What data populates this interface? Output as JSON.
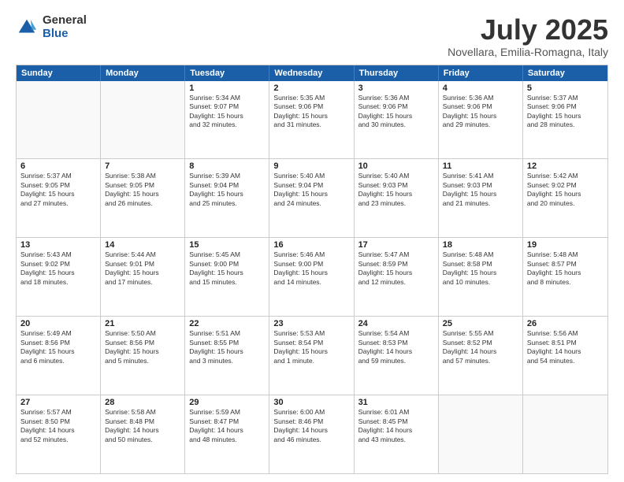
{
  "logo": {
    "general": "General",
    "blue": "Blue"
  },
  "title": "July 2025",
  "location": "Novellara, Emilia-Romagna, Italy",
  "weekdays": [
    "Sunday",
    "Monday",
    "Tuesday",
    "Wednesday",
    "Thursday",
    "Friday",
    "Saturday"
  ],
  "weeks": [
    [
      {
        "day": "",
        "detail": ""
      },
      {
        "day": "",
        "detail": ""
      },
      {
        "day": "1",
        "detail": "Sunrise: 5:34 AM\nSunset: 9:07 PM\nDaylight: 15 hours\nand 32 minutes."
      },
      {
        "day": "2",
        "detail": "Sunrise: 5:35 AM\nSunset: 9:06 PM\nDaylight: 15 hours\nand 31 minutes."
      },
      {
        "day": "3",
        "detail": "Sunrise: 5:36 AM\nSunset: 9:06 PM\nDaylight: 15 hours\nand 30 minutes."
      },
      {
        "day": "4",
        "detail": "Sunrise: 5:36 AM\nSunset: 9:06 PM\nDaylight: 15 hours\nand 29 minutes."
      },
      {
        "day": "5",
        "detail": "Sunrise: 5:37 AM\nSunset: 9:06 PM\nDaylight: 15 hours\nand 28 minutes."
      }
    ],
    [
      {
        "day": "6",
        "detail": "Sunrise: 5:37 AM\nSunset: 9:05 PM\nDaylight: 15 hours\nand 27 minutes."
      },
      {
        "day": "7",
        "detail": "Sunrise: 5:38 AM\nSunset: 9:05 PM\nDaylight: 15 hours\nand 26 minutes."
      },
      {
        "day": "8",
        "detail": "Sunrise: 5:39 AM\nSunset: 9:04 PM\nDaylight: 15 hours\nand 25 minutes."
      },
      {
        "day": "9",
        "detail": "Sunrise: 5:40 AM\nSunset: 9:04 PM\nDaylight: 15 hours\nand 24 minutes."
      },
      {
        "day": "10",
        "detail": "Sunrise: 5:40 AM\nSunset: 9:03 PM\nDaylight: 15 hours\nand 23 minutes."
      },
      {
        "day": "11",
        "detail": "Sunrise: 5:41 AM\nSunset: 9:03 PM\nDaylight: 15 hours\nand 21 minutes."
      },
      {
        "day": "12",
        "detail": "Sunrise: 5:42 AM\nSunset: 9:02 PM\nDaylight: 15 hours\nand 20 minutes."
      }
    ],
    [
      {
        "day": "13",
        "detail": "Sunrise: 5:43 AM\nSunset: 9:02 PM\nDaylight: 15 hours\nand 18 minutes."
      },
      {
        "day": "14",
        "detail": "Sunrise: 5:44 AM\nSunset: 9:01 PM\nDaylight: 15 hours\nand 17 minutes."
      },
      {
        "day": "15",
        "detail": "Sunrise: 5:45 AM\nSunset: 9:00 PM\nDaylight: 15 hours\nand 15 minutes."
      },
      {
        "day": "16",
        "detail": "Sunrise: 5:46 AM\nSunset: 9:00 PM\nDaylight: 15 hours\nand 14 minutes."
      },
      {
        "day": "17",
        "detail": "Sunrise: 5:47 AM\nSunset: 8:59 PM\nDaylight: 15 hours\nand 12 minutes."
      },
      {
        "day": "18",
        "detail": "Sunrise: 5:48 AM\nSunset: 8:58 PM\nDaylight: 15 hours\nand 10 minutes."
      },
      {
        "day": "19",
        "detail": "Sunrise: 5:48 AM\nSunset: 8:57 PM\nDaylight: 15 hours\nand 8 minutes."
      }
    ],
    [
      {
        "day": "20",
        "detail": "Sunrise: 5:49 AM\nSunset: 8:56 PM\nDaylight: 15 hours\nand 6 minutes."
      },
      {
        "day": "21",
        "detail": "Sunrise: 5:50 AM\nSunset: 8:56 PM\nDaylight: 15 hours\nand 5 minutes."
      },
      {
        "day": "22",
        "detail": "Sunrise: 5:51 AM\nSunset: 8:55 PM\nDaylight: 15 hours\nand 3 minutes."
      },
      {
        "day": "23",
        "detail": "Sunrise: 5:53 AM\nSunset: 8:54 PM\nDaylight: 15 hours\nand 1 minute."
      },
      {
        "day": "24",
        "detail": "Sunrise: 5:54 AM\nSunset: 8:53 PM\nDaylight: 14 hours\nand 59 minutes."
      },
      {
        "day": "25",
        "detail": "Sunrise: 5:55 AM\nSunset: 8:52 PM\nDaylight: 14 hours\nand 57 minutes."
      },
      {
        "day": "26",
        "detail": "Sunrise: 5:56 AM\nSunset: 8:51 PM\nDaylight: 14 hours\nand 54 minutes."
      }
    ],
    [
      {
        "day": "27",
        "detail": "Sunrise: 5:57 AM\nSunset: 8:50 PM\nDaylight: 14 hours\nand 52 minutes."
      },
      {
        "day": "28",
        "detail": "Sunrise: 5:58 AM\nSunset: 8:48 PM\nDaylight: 14 hours\nand 50 minutes."
      },
      {
        "day": "29",
        "detail": "Sunrise: 5:59 AM\nSunset: 8:47 PM\nDaylight: 14 hours\nand 48 minutes."
      },
      {
        "day": "30",
        "detail": "Sunrise: 6:00 AM\nSunset: 8:46 PM\nDaylight: 14 hours\nand 46 minutes."
      },
      {
        "day": "31",
        "detail": "Sunrise: 6:01 AM\nSunset: 8:45 PM\nDaylight: 14 hours\nand 43 minutes."
      },
      {
        "day": "",
        "detail": ""
      },
      {
        "day": "",
        "detail": ""
      }
    ]
  ]
}
